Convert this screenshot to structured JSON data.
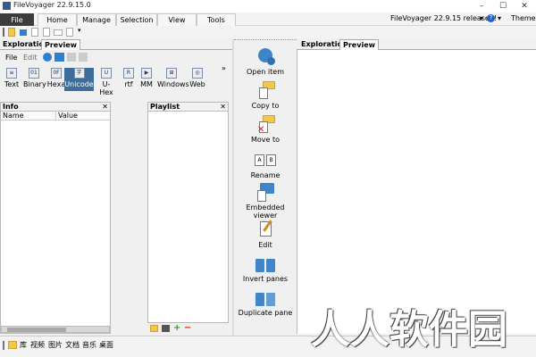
{
  "window": {
    "title": "FileVoyager 22.9.15.0",
    "controls": {
      "minimize": "–",
      "maximize": "☐",
      "close": "✕"
    }
  },
  "menubar": {
    "tabs": [
      "File",
      "Home",
      "Manage",
      "Selection",
      "View",
      "Tools"
    ],
    "release_notice": "FileVoyager 22.9.15 released!",
    "themes_label": "Themes"
  },
  "left_panel": {
    "tabs": [
      "Exploration",
      "Preview"
    ],
    "subtabs": [
      "File",
      "Edit"
    ],
    "viewer_buttons": [
      "Text",
      "Binary",
      "Hexa",
      "Unicode",
      "U-Hex",
      "rtf",
      "MM",
      "Windows",
      "Web"
    ],
    "active_viewer": "Unicode"
  },
  "info_panel": {
    "title": "Info",
    "columns": [
      "Name",
      "Value"
    ]
  },
  "playlist_panel": {
    "title": "Playlist"
  },
  "actions": [
    {
      "label": "Open item",
      "icon": "gears-icon"
    },
    {
      "label": "Copy to",
      "icon": "copy-to-icon"
    },
    {
      "label": "Move to",
      "icon": "move-to-icon"
    },
    {
      "label": "Rename",
      "icon": "rename-icon"
    },
    {
      "label": "Embedded viewer",
      "icon": "embedded-viewer-icon"
    },
    {
      "label": "Edit",
      "icon": "edit-icon"
    },
    {
      "label": "Invert panes",
      "icon": "invert-panes-icon"
    },
    {
      "label": "Duplicate pane",
      "icon": "duplicate-pane-icon"
    }
  ],
  "right_panel": {
    "tabs": [
      "Exploration",
      "Preview"
    ]
  },
  "bottombar": {
    "items": [
      "库",
      "视频",
      "图片",
      "文档",
      "音乐",
      "桌面"
    ]
  },
  "watermark": "人人软件园",
  "colors": {
    "accent": "#3e6d9c",
    "file_tab": "#3c3c3c",
    "help": "#1e62c3"
  }
}
